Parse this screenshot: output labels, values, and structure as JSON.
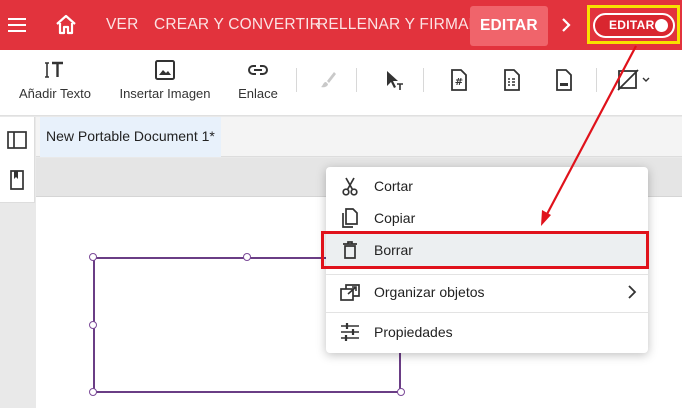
{
  "topbar": {
    "nav": [
      "VER",
      "CREAR Y CONVERTIR",
      "RELLENAR Y FIRMAR",
      "EDITAR"
    ],
    "edit_toggle_label": "EDITAR"
  },
  "toolbar": {
    "add_text": "Añadir Texto",
    "insert_image": "Insertar Imagen",
    "link": "Enlace"
  },
  "document": {
    "tab_title": "New Portable Document 1*"
  },
  "context_menu": {
    "items": [
      "Cortar",
      "Copiar",
      "Borrar",
      "Organizar objetos",
      "Propiedades"
    ]
  },
  "colors": {
    "brand": "#e2333d",
    "highlight_box": "#f8e100",
    "callout": "#e0121b",
    "shape_stroke": "#6a3d85"
  },
  "icons": [
    "hamburger-icon",
    "home-icon",
    "chevron-right-icon",
    "text-icon",
    "image-icon",
    "link-icon",
    "brush-icon",
    "select-text-icon",
    "header-footer-icon",
    "bates-icon",
    "page-number-icon",
    "shape-icon",
    "panel-icon",
    "bookmark-icon",
    "scissors-icon",
    "copy-icon",
    "trash-icon",
    "arrange-icon",
    "properties-icon"
  ]
}
